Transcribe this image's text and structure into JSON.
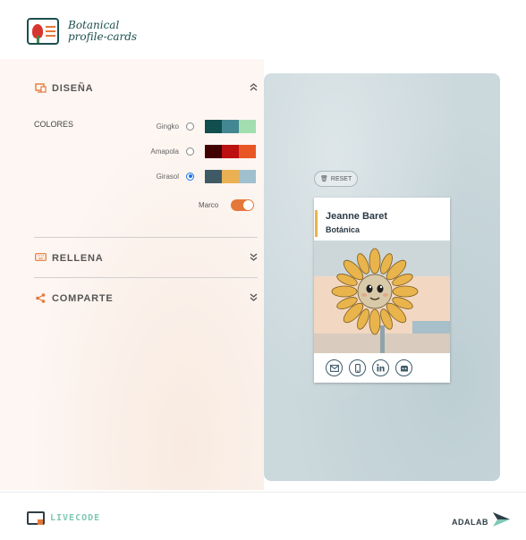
{
  "header": {
    "logo_line1": "Botanical",
    "logo_line2": "profile-cards"
  },
  "sections": {
    "design": {
      "title": "DISEÑA",
      "icon": "monitor-design-icon"
    },
    "fill": {
      "title": "RELLENA",
      "icon": "keyboard-icon"
    },
    "share": {
      "title": "COMPARTE",
      "icon": "share-icon"
    }
  },
  "colors": {
    "label": "COLORES",
    "palettes": [
      {
        "name": "Gingko",
        "selected": false,
        "swatches": [
          "#114e4e",
          "#438792",
          "#a2deaf"
        ]
      },
      {
        "name": "Amapola",
        "selected": false,
        "swatches": [
          "#420101",
          "#bd1010",
          "#e95626"
        ]
      },
      {
        "name": "Girasol",
        "selected": true,
        "swatches": [
          "#3e5b65",
          "#eab052",
          "#a0c0cf"
        ]
      }
    ],
    "marco_label": "Marco",
    "marco_on": true,
    "accent": "#e4783a"
  },
  "preview": {
    "reset_label": "RESET",
    "card": {
      "name": "Jeanne Baret",
      "job": "Botánica",
      "social_icons": [
        "email-icon",
        "phone-icon",
        "linkedin-icon",
        "github-icon"
      ]
    }
  },
  "footer": {
    "livecode": "LIVECODE",
    "adalab": "ADALAB"
  }
}
